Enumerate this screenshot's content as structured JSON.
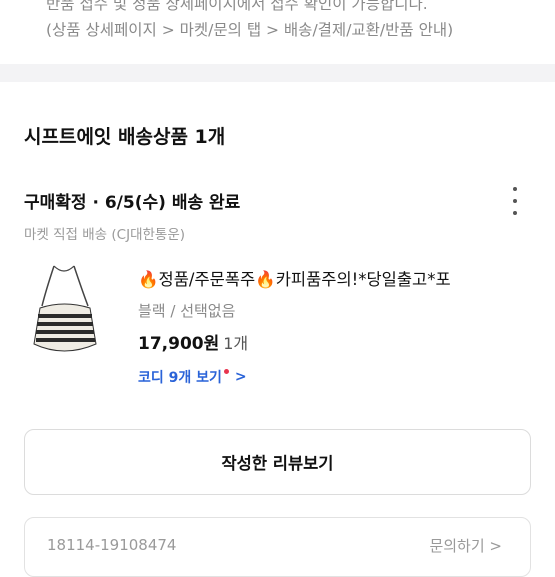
{
  "notice": {
    "line1": "반품 접수 및 정품 상세페이지에서 접수 확인이 가능합니다.",
    "line2": "(상품 상세페이지 > 마켓/문의 탭 > 배송/결제/교환/반품 안내)"
  },
  "shipment": {
    "title": "시프트에잇 배송상품 1개",
    "status": "구매확정 · 6/5(수) 배송 완료",
    "method": "마켓 직접 배송 (CJ대한통운)"
  },
  "product": {
    "name": "🔥정품/주문폭주🔥카피품주의!*당일출고*포",
    "option": "블랙 / 선택없음",
    "price": "17,900원",
    "quantity": "1개",
    "coordi_link": "코디 9개 보기"
  },
  "review_button": "작성한 리뷰보기",
  "order": {
    "number": "18114-19108474",
    "inquiry": "문의하기"
  },
  "colors": {
    "accent_blue": "#2a63d8",
    "badge_red": "#e8344e"
  },
  "icons": [
    "more-vertical-icon",
    "chevron-right-icon"
  ]
}
